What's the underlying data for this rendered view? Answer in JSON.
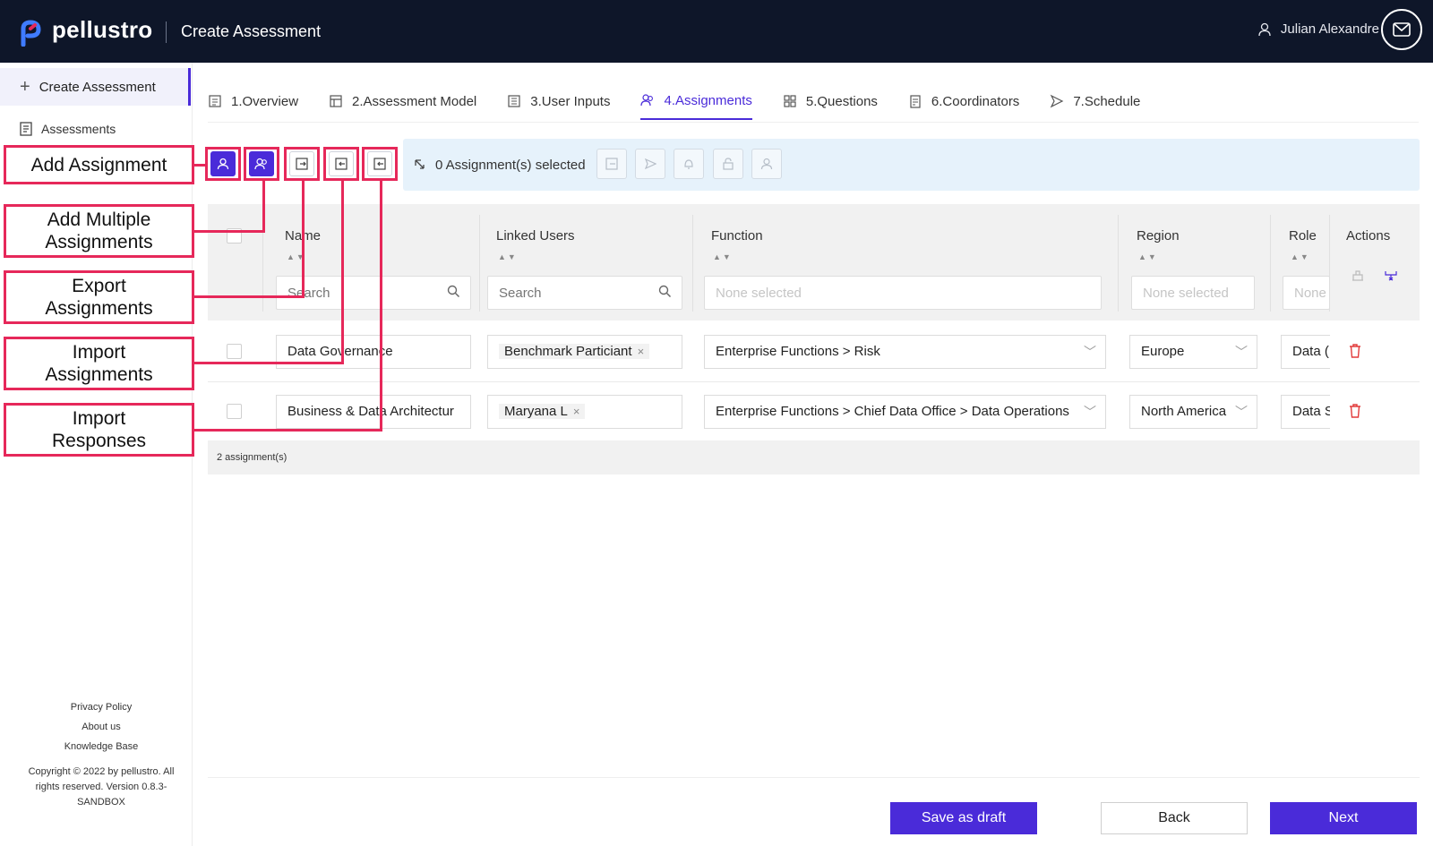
{
  "header": {
    "brand": "pellustro",
    "page_title": "Create Assessment",
    "user_name": "Julian Alexandre",
    "colors": {
      "bg": "#0e1629",
      "accent": "#4a2bd9"
    }
  },
  "sidebar": {
    "create_label": "Create Assessment",
    "items": [
      {
        "label": "Assessments",
        "icon": "list-icon"
      }
    ],
    "footer": {
      "privacy": "Privacy Policy",
      "about": "About us",
      "kb": "Knowledge Base",
      "copyright_1": "Copyright © 2022 by pellustro. All",
      "copyright_2": "rights reserved. Version 0.8.3-",
      "copyright_3": "SANDBOX"
    }
  },
  "tabs": [
    {
      "label": "1.Overview",
      "icon": "document-icon"
    },
    {
      "label": "2.Assessment Model",
      "icon": "layout-icon"
    },
    {
      "label": "3.User Inputs",
      "icon": "form-icon"
    },
    {
      "label": "4.Assignments",
      "icon": "users-icon",
      "active": true
    },
    {
      "label": "5.Questions",
      "icon": "grid-icon"
    },
    {
      "label": "6.Coordinators",
      "icon": "clipboard-icon"
    },
    {
      "label": "7.Schedule",
      "icon": "send-icon"
    }
  ],
  "toolbar": {
    "selected_text": "0 Assignment(s) selected"
  },
  "callouts": {
    "add_assignment": "Add Assignment",
    "add_multiple_1": "Add Multiple",
    "add_multiple_2": "Assignments",
    "export_1": "Export",
    "export_2": "Assignments",
    "import_assign_1": "Import",
    "import_assign_2": "Assignments",
    "import_resp_1": "Import",
    "import_resp_2": "Responses"
  },
  "table": {
    "columns": {
      "name": "Name",
      "linked_users": "Linked Users",
      "function": "Function",
      "region": "Region",
      "role": "Role",
      "actions": "Actions"
    },
    "filters": {
      "name_placeholder": "Search",
      "users_placeholder": "Search",
      "function_placeholder": "None selected",
      "region_placeholder": "None selected",
      "role_placeholder": "None"
    },
    "rows": [
      {
        "name": "Data Governance",
        "user": "Benchmark Particiant",
        "function": "Enterprise Functions > Risk",
        "region": "Europe",
        "role": "Data ("
      },
      {
        "name": "Business & Data Architectur",
        "user": "Maryana L",
        "function": "Enterprise Functions > Chief Data Office > Data Operations",
        "region": "North America",
        "role": "Data S"
      }
    ],
    "footer": "2 assignment(s)"
  },
  "buttons": {
    "save_draft": "Save as draft",
    "back": "Back",
    "next": "Next"
  }
}
